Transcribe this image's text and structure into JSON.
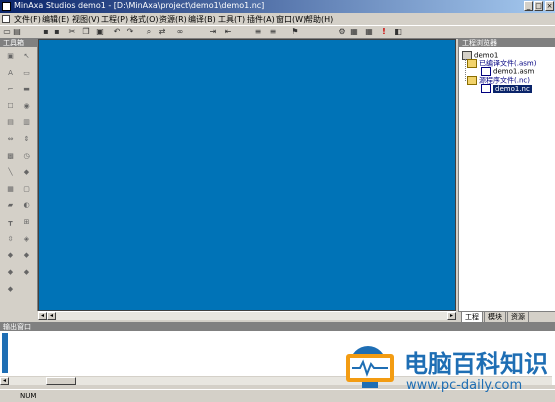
{
  "title": "MinAxa Studios demo1 - [D:\\MinAxa\\project\\demo1\\demo1.nc]",
  "window_controls": [
    "_",
    "□",
    "×"
  ],
  "menu": [
    "文件(F)",
    "编辑(E)",
    "视图(V)",
    "工程(P)",
    "格式(O)",
    "资源(R)",
    "编译(B)",
    "工具(T)",
    "插件(A)",
    "窗口(W)",
    "帮助(H)"
  ],
  "toolbar_icons": [
    "new-icon",
    "open-icon",
    "save-icon",
    "save-all-icon",
    "cut-icon",
    "copy-icon",
    "paste-icon",
    "undo-icon",
    "redo-icon",
    "find-icon",
    "replace-icon",
    "binoculars-icon",
    "indent-icon",
    "outdent-icon",
    "comment-icon",
    "uncomment-icon",
    "bookmark-icon",
    "compile-icon",
    "build-icon",
    "run-icon",
    "stop-icon"
  ],
  "toolbox": {
    "title": "工具箱"
  },
  "project_panel": {
    "title": "工程浏览器",
    "tree": [
      {
        "label": "demo1",
        "level": 0,
        "icon": "project-icon"
      },
      {
        "label": "已编译文件(.asm)",
        "level": 1,
        "icon": "folder-icon"
      },
      {
        "label": "demo1.asm",
        "level": 2,
        "icon": "file-icon"
      },
      {
        "label": "源程序文件(.nc)",
        "level": 1,
        "icon": "folder-icon"
      },
      {
        "label": "demo1.nc",
        "level": 2,
        "icon": "file-icon",
        "selected": true
      }
    ],
    "tabs": [
      "工程",
      "模块",
      "资源"
    ]
  },
  "output": {
    "title": "输出窗口"
  },
  "status": {
    "indicator": "NUM"
  },
  "watermark": {
    "text": "电脑百科知识",
    "url": "www.pc-daily.com"
  },
  "colors": {
    "editor_bg": "#0073b7",
    "chrome": "#d4d0c8",
    "titlebar": "#0a246a",
    "watermark": "#1e6eb4"
  }
}
